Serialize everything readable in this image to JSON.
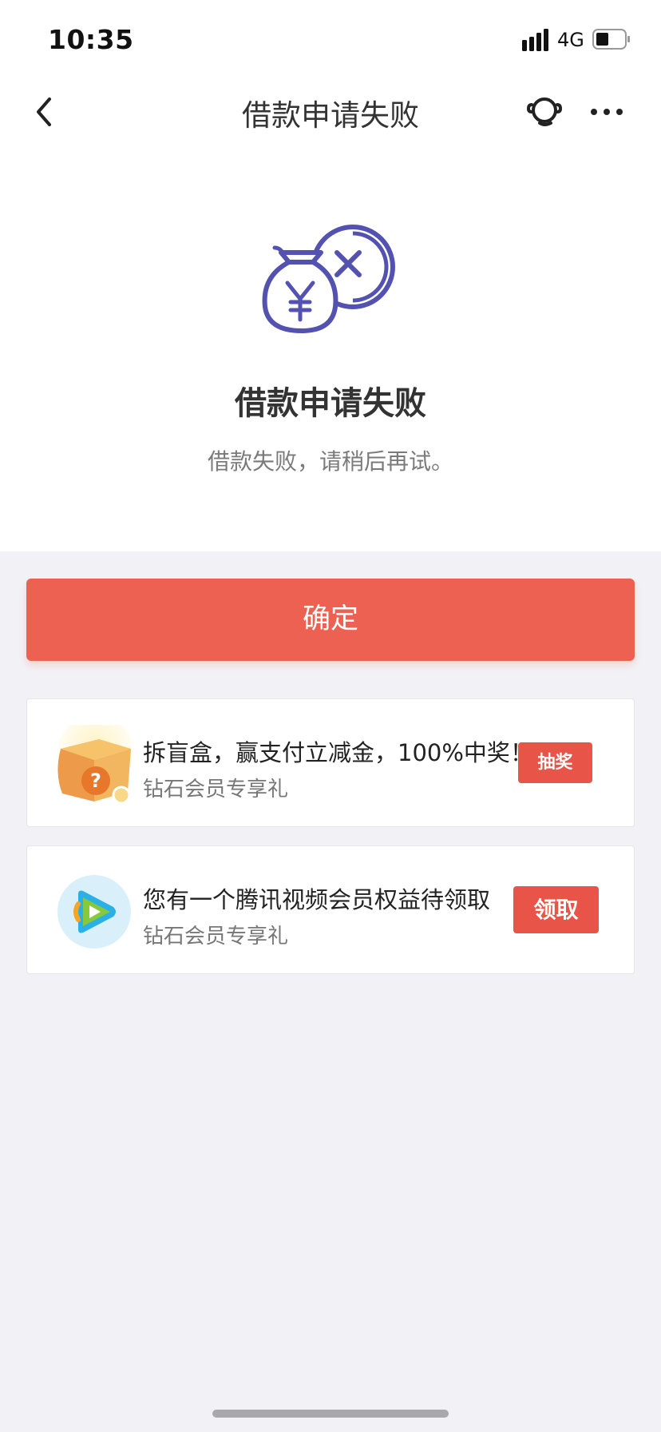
{
  "status_bar": {
    "time": "10:35",
    "network": "4G",
    "signal_icon": "signal-bars-icon",
    "battery_icon": "battery-icon"
  },
  "nav": {
    "title": "借款申请失败",
    "back_icon": "chevron-left-icon",
    "service_icon": "customer-service-icon",
    "more_icon": "more-dots-icon"
  },
  "result": {
    "icon": "money-bag-cancel-icon",
    "title": "借款申请失败",
    "description": "借款失败，请稍后再试。"
  },
  "confirm_button": {
    "label": "确定"
  },
  "cards": [
    {
      "icon": "blind-box-icon",
      "title": "拆盲盒，赢支付立减金，100%中奖！",
      "subtitle": "钻石会员专享礼",
      "button": "抽奖"
    },
    {
      "icon": "tencent-video-icon",
      "title": "您有一个腾讯视频会员权益待领取",
      "subtitle": "钻石会员专享礼",
      "button": "领取"
    }
  ],
  "colors": {
    "accent": "#ec6152",
    "illustration": "#5452b0",
    "background": "#f2f2f6"
  }
}
